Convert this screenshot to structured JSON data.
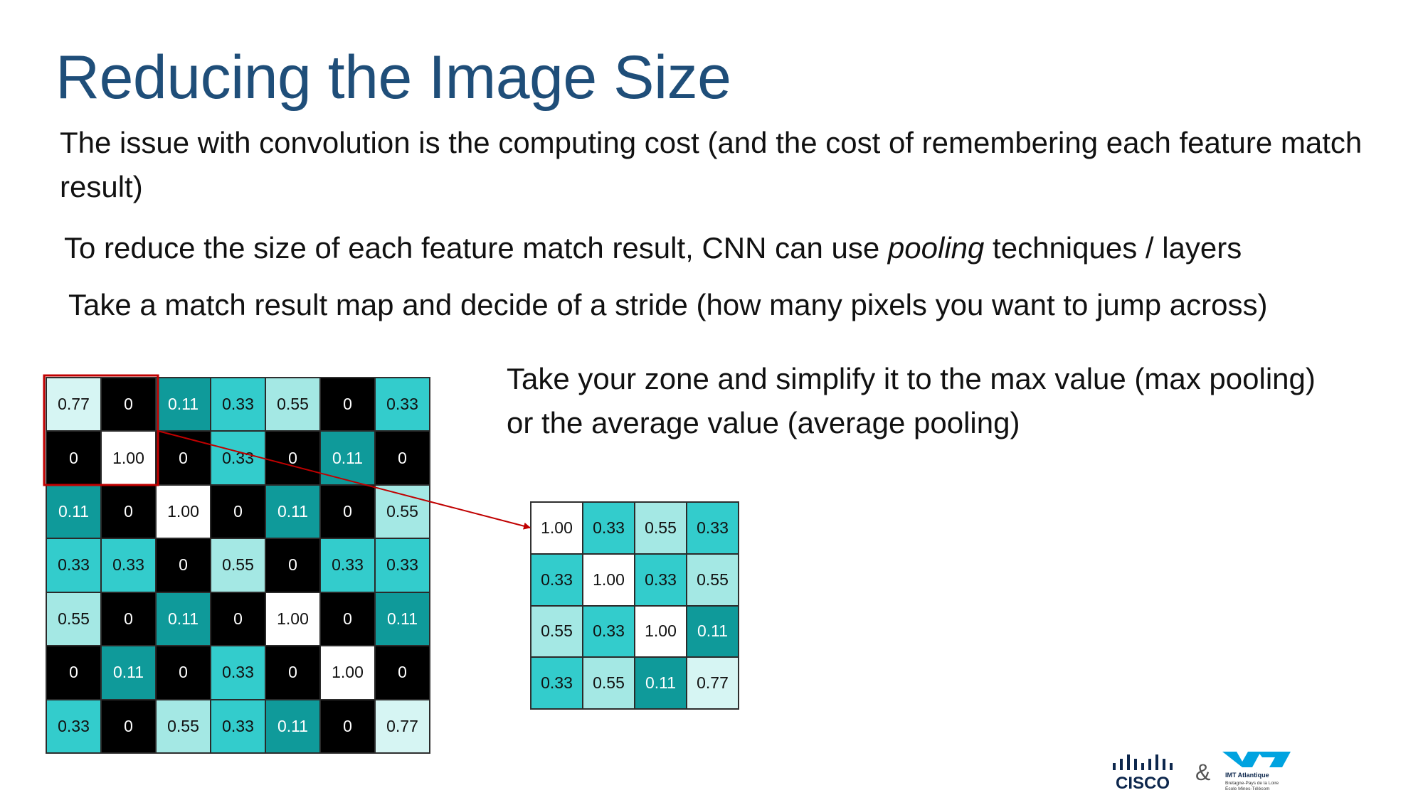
{
  "slide": {
    "title": "Reducing the Image Size",
    "paragraph1": "The issue with convolution is the computing cost (and the cost of remembering each feature match result)",
    "paragraph2_before": "To reduce the size of each feature match result, CNN can use ",
    "paragraph2_emphasis": "pooling",
    "paragraph2_after": " techniques / layers",
    "paragraph3": "Take a match result map and decide of a stride (how many pixels you want to jump across)",
    "paragraph4": "Take your zone and simplify it to the max value (max pooling) or the average value (average pooling)"
  },
  "colors": {
    "title": "#1f4e79",
    "c0": "#000000",
    "c011": "#0f9a9a",
    "c033": "#33cccc",
    "c055": "#a4e8e4",
    "c077": "#d6f5f3",
    "c100": "#ffffff",
    "highlight": "#c00000"
  },
  "feature_map": [
    [
      "0.77",
      "0",
      "0.11",
      "0.33",
      "0.55",
      "0",
      "0.33"
    ],
    [
      "0",
      "1.00",
      "0",
      "0.33",
      "0",
      "0.11",
      "0"
    ],
    [
      "0.11",
      "0",
      "1.00",
      "0",
      "0.11",
      "0",
      "0.55"
    ],
    [
      "0.33",
      "0.33",
      "0",
      "0.55",
      "0",
      "0.33",
      "0.33"
    ],
    [
      "0.55",
      "0",
      "0.11",
      "0",
      "1.00",
      "0",
      "0.11"
    ],
    [
      "0",
      "0.11",
      "0",
      "0.33",
      "0",
      "1.00",
      "0"
    ],
    [
      "0.33",
      "0",
      "0.55",
      "0.33",
      "0.11",
      "0",
      "0.77"
    ]
  ],
  "pooled_map": [
    [
      "1.00",
      "0.33",
      "0.55",
      "0.33"
    ],
    [
      "0.33",
      "1.00",
      "0.33",
      "0.55"
    ],
    [
      "0.55",
      "0.33",
      "1.00",
      "0.11"
    ],
    [
      "0.33",
      "0.55",
      "0.11",
      "0.77"
    ]
  ],
  "logos": {
    "cisco": "CISCO",
    "ampersand": "&",
    "imt_name": "IMT Atlantique",
    "imt_line2": "Bretagne-Pays de la Loire",
    "imt_line3": "École Mines-Télécom"
  }
}
